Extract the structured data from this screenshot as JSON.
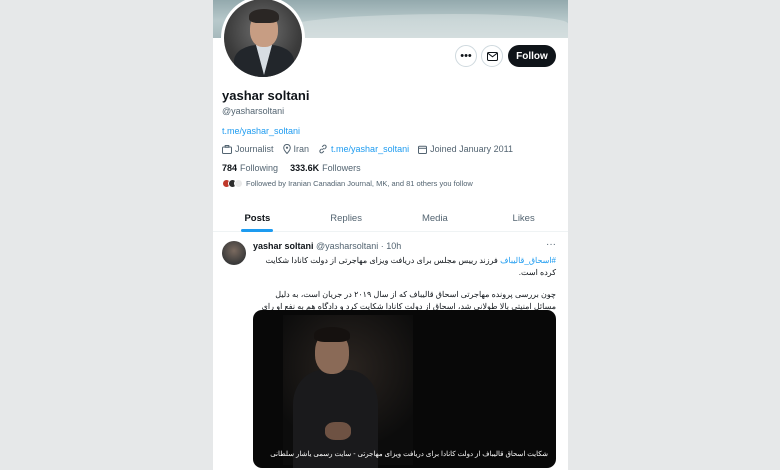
{
  "profile": {
    "name": "yashar soltani",
    "handle": "@yasharsoltani",
    "bio_link": "t.me/yashar_soltani",
    "occupation": "Journalist",
    "location": "Iran",
    "website": "t.me/yashar_soltani",
    "joined": "Joined January 2011",
    "following_count": "784",
    "following_label": "Following",
    "followers_count": "333.6K",
    "followers_label": "Followers",
    "followed_by": "Followed by Iranian Canadian Journal, MK, and 81 others you follow",
    "follow_button": "Follow",
    "more_icon": "more-icon",
    "message_icon": "message-icon"
  },
  "tabs": [
    {
      "label": "Posts",
      "active": true
    },
    {
      "label": "Replies",
      "active": false
    },
    {
      "label": "Media",
      "active": false
    },
    {
      "label": "Likes",
      "active": false
    }
  ],
  "post": {
    "author": "yashar soltani",
    "handle_time": "@yasharsoltani · 10h",
    "hashtag": "#اسحاق_قالیباف",
    "line1": " فرزند رییس مجلس برای دریافت ویزای مهاجرتی از دولت کانادا شکایت کرده است.",
    "paragraph2": "چون بررسی پرونده مهاجرتی اسحاق قالیباف که از سال ۲۰۱۹ در جریان است، به دلیل مسائل امنیتی بالا طولانی شد، اسحاق از دولت کانادا شکایت کرد و دادگاه هم به نفع او رای داد.",
    "media_caption": "شکایت اسحاق قالیباف از دولت کانادا برای دریافت ویزای مهاجرتی - سایت رسمی یاشار سلطانی"
  },
  "colors": {
    "accent": "#1d9bf0",
    "text": "#0f1419",
    "muted": "#536471",
    "follow_bg": "#0f1419"
  }
}
